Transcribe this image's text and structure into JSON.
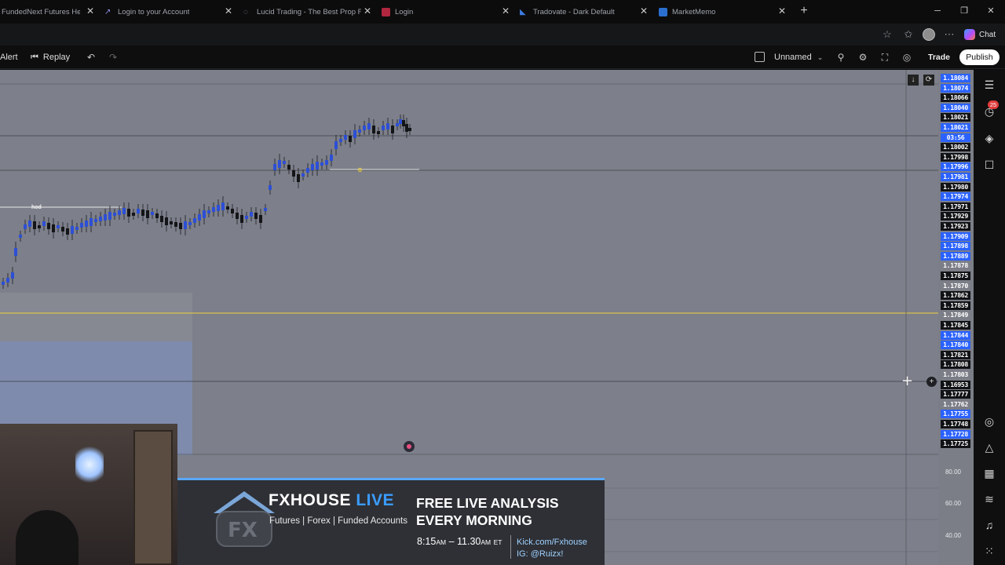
{
  "browser": {
    "tabs": [
      {
        "title": "FundedNext Futures Help",
        "favicon_color": "#1d8cf8"
      },
      {
        "title": "Login to your Account",
        "favicon_color": "#5b5bd6"
      },
      {
        "title": "Lucid Trading - The Best Prop Firm",
        "favicon_color": "#6b6f78"
      },
      {
        "title": "Login",
        "favicon_color": "#c12a4b"
      },
      {
        "title": "Tradovate - Dark Default",
        "favicon_color": "#1f5fbf"
      },
      {
        "title": "MarketMemo",
        "favicon_color": "#2b73d8"
      }
    ],
    "chat_label": "Chat"
  },
  "toolbar": {
    "alert_label": "Alert",
    "replay_label": "Replay",
    "layout_name": "Unnamed",
    "trade_label": "Trade",
    "publish_label": "Publish"
  },
  "notifications": {
    "count": "25"
  },
  "price_axis": {
    "labels": [
      {
        "value": "1.18084",
        "style": "blue"
      },
      {
        "value": "1.18074",
        "style": "blue"
      },
      {
        "value": "1.18066",
        "style": "black"
      },
      {
        "value": "1.18040",
        "style": "blue"
      },
      {
        "value": "1.18021",
        "style": "black"
      },
      {
        "value": "1.18021",
        "style": "blue"
      },
      {
        "value": "03:56",
        "style": "blue"
      },
      {
        "value": "1.18002",
        "style": "black"
      },
      {
        "value": "1.17998",
        "style": "black"
      },
      {
        "value": "1.17996",
        "style": "blue"
      },
      {
        "value": "1.17981",
        "style": "blue"
      },
      {
        "value": "1.17980",
        "style": "black"
      },
      {
        "value": "1.17974",
        "style": "blue"
      },
      {
        "value": "1.17971",
        "style": "black"
      },
      {
        "value": "1.17929",
        "style": "black"
      },
      {
        "value": "1.17923",
        "style": "black"
      },
      {
        "value": "1.17909",
        "style": "blue"
      },
      {
        "value": "1.17898",
        "style": "blue"
      },
      {
        "value": "1.17889",
        "style": "blue"
      },
      {
        "value": "1.17878",
        "style": "plain"
      },
      {
        "value": "1.17875",
        "style": "black"
      },
      {
        "value": "1.17870",
        "style": "plain"
      },
      {
        "value": "1.17862",
        "style": "black"
      },
      {
        "value": "1.17859",
        "style": "black"
      },
      {
        "value": "1.17849",
        "style": "plain"
      },
      {
        "value": "1.17845",
        "style": "black"
      },
      {
        "value": "1.17844",
        "style": "blue"
      },
      {
        "value": "1.17840",
        "style": "blue"
      },
      {
        "value": "1.17821",
        "style": "black"
      },
      {
        "value": "1.17808",
        "style": "black"
      },
      {
        "value": "1.17803",
        "style": "plain"
      },
      {
        "value": "1.16953",
        "style": "black"
      },
      {
        "value": "1.17777",
        "style": "black"
      },
      {
        "value": "1.17762",
        "style": "plain"
      },
      {
        "value": "1.17755",
        "style": "blue"
      },
      {
        "value": "1.17748",
        "style": "black"
      },
      {
        "value": "1.17728",
        "style": "blue"
      },
      {
        "value": "1.17725",
        "style": "black"
      }
    ],
    "lower_ticks": [
      "80.00",
      "60.00",
      "40.00"
    ]
  },
  "chart_labels": {
    "hod": "hod"
  },
  "banner": {
    "brand": "FXHOUSE",
    "brand_live": "LIVE",
    "tagline": "Futures | Forex | Funded Accounts",
    "headline": "FREE LIVE ANALYSIS EVERY MORNING",
    "time_start": "8:15",
    "time_start_unit": "AM",
    "time_sep": " – ",
    "time_end": "11.30",
    "time_end_unit": "AM",
    "time_zone": "ET",
    "link_kick": "Kick.com/Fxhouse",
    "link_ig": "IG: @Ruizx!"
  }
}
